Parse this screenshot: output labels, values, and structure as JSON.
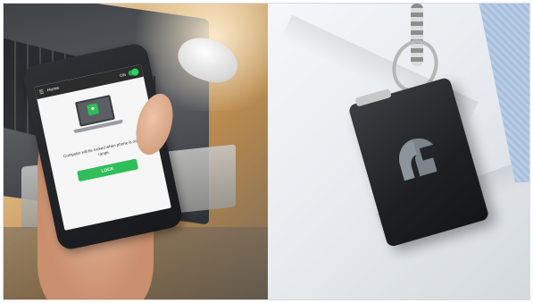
{
  "phone": {
    "app_title": "Home",
    "toggle_label": "ON",
    "message": "Computer will be locked when phone is out of range.",
    "lock_label": "LOCK",
    "accent_color": "#2fbe5a"
  },
  "icons": {
    "menu": "menu-icon",
    "lock": "lock-icon",
    "device_logo": "helmet-logo-icon"
  }
}
